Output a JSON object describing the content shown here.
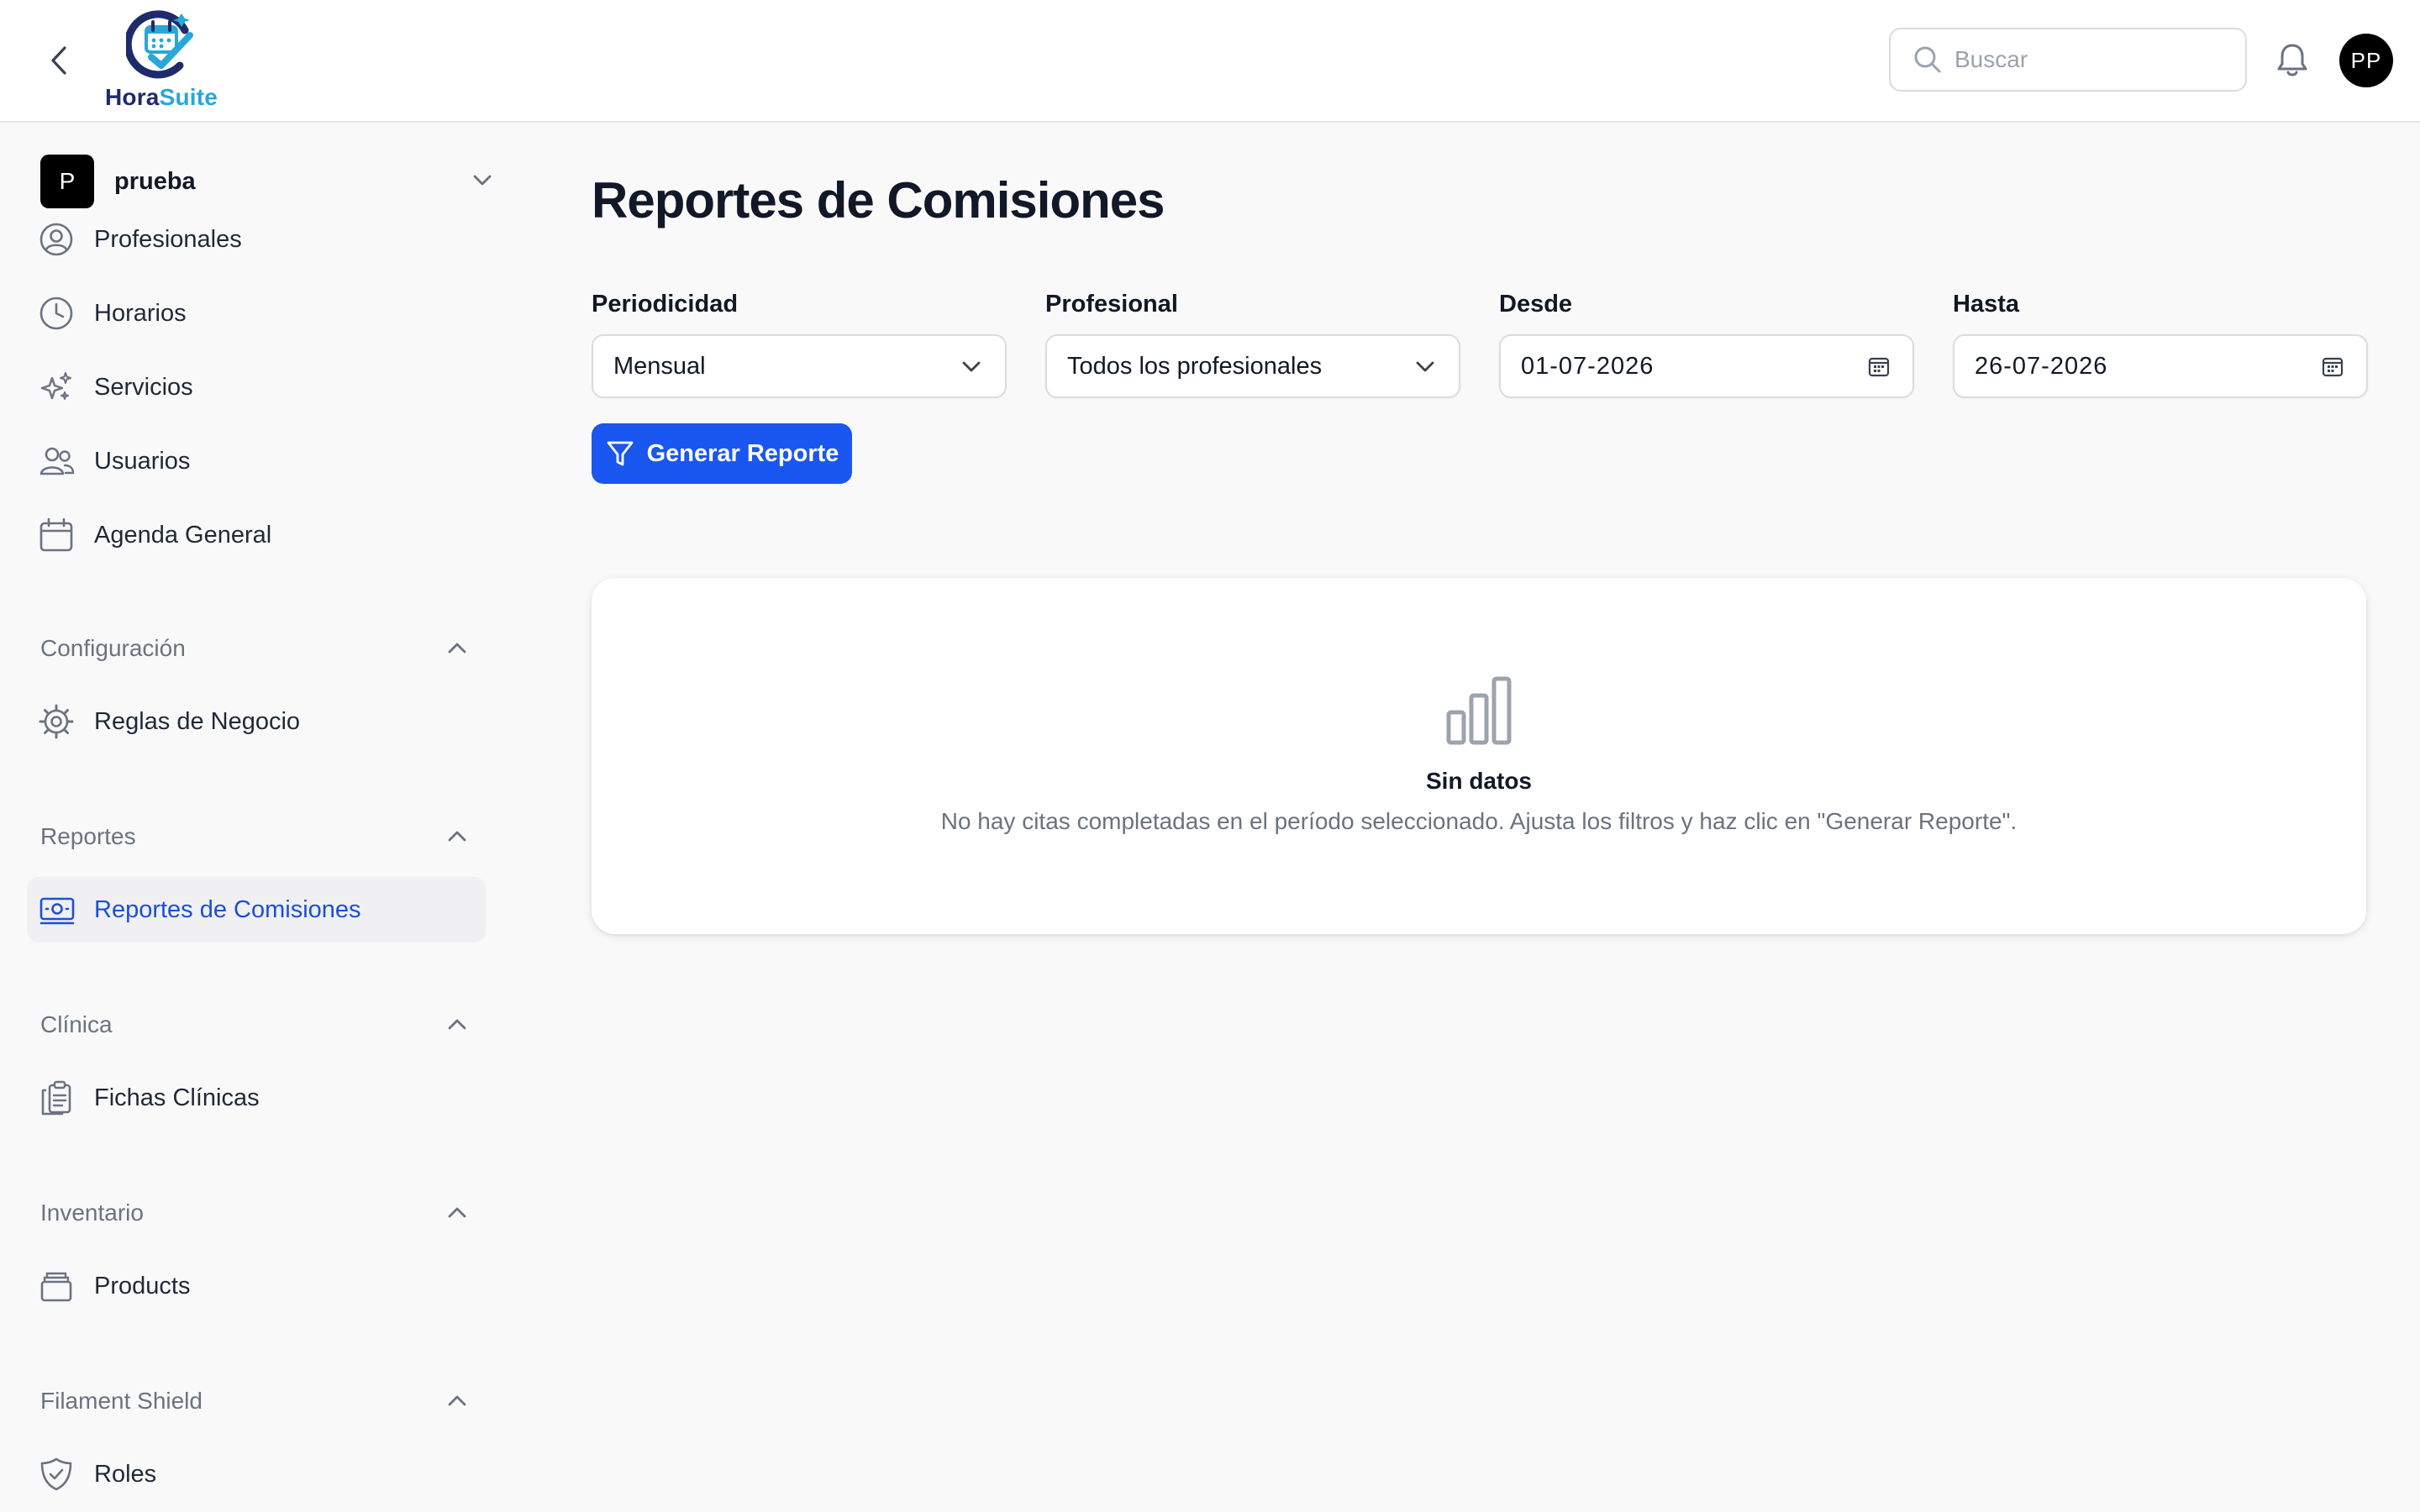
{
  "app": {
    "logo_text_1": "Hora",
    "logo_text_2": "Suite"
  },
  "topbar": {
    "search_placeholder": "Buscar",
    "avatar_initials": "PP"
  },
  "sidebar": {
    "tenant": {
      "badge": "P",
      "name": "prueba"
    },
    "items": [
      {
        "label": "Profesionales",
        "icon": "user-circle-icon"
      },
      {
        "label": "Horarios",
        "icon": "clock-icon"
      },
      {
        "label": "Servicios",
        "icon": "sparkles-icon"
      },
      {
        "label": "Usuarios",
        "icon": "users-icon"
      },
      {
        "label": "Agenda General",
        "icon": "calendar-icon"
      }
    ],
    "groups": [
      {
        "label": "Configuración",
        "items": [
          {
            "label": "Reglas de Negocio",
            "icon": "cog-icon"
          }
        ]
      },
      {
        "label": "Reportes",
        "items": [
          {
            "label": "Reportes de Comisiones",
            "icon": "banknotes-icon",
            "active": true
          }
        ]
      },
      {
        "label": "Clínica",
        "items": [
          {
            "label": "Fichas Clínicas",
            "icon": "clipboard-documents-icon"
          }
        ]
      },
      {
        "label": "Inventario",
        "items": [
          {
            "label": "Products",
            "icon": "archive-box-icon"
          }
        ]
      },
      {
        "label": "Filament Shield",
        "items": [
          {
            "label": "Roles",
            "icon": "shield-check-icon"
          }
        ]
      }
    ]
  },
  "main": {
    "title": "Reportes de Comisiones",
    "filters": {
      "periodicidad": {
        "label": "Periodicidad",
        "value": "Mensual"
      },
      "profesional": {
        "label": "Profesional",
        "value": "Todos los profesionales"
      },
      "desde": {
        "label": "Desde",
        "value": "01-07-2026"
      },
      "hasta": {
        "label": "Hasta",
        "value": "26-07-2026"
      }
    },
    "generate_button": "Generar Reporte",
    "empty_state": {
      "icon": "bar-chart-icon",
      "title": "Sin datos",
      "description": "No hay citas completadas en el período seleccionado. Ajusta los filtros y haz clic en \"Generar Reporte\"."
    }
  },
  "colors": {
    "primary": "#1a56f0",
    "active_text": "#1d4ed8",
    "active_bg": "#f0f0f2",
    "page_bg": "#f9f9fa",
    "logo_navy": "#1e2b6b",
    "logo_cyan": "#2aa6d9"
  }
}
